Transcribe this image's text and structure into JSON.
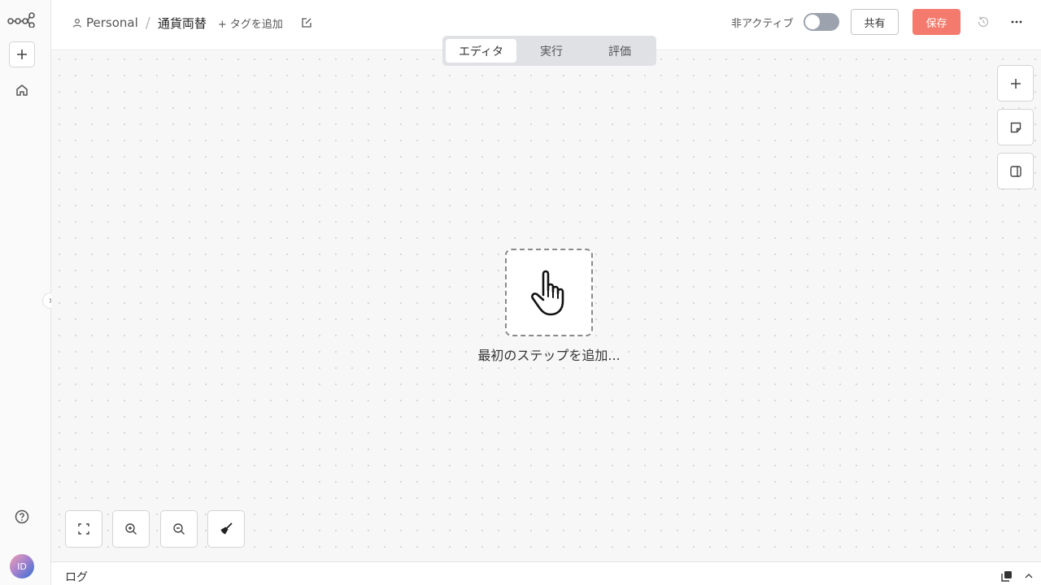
{
  "sidebar": {
    "logo_icon": "workflow-logo-icon",
    "avatar_initials": "ID"
  },
  "header": {
    "project": "Personal",
    "separator": "/",
    "workflow_title": "通貨両替",
    "add_tag": "+ タグを追加",
    "status_label": "非アクティブ",
    "active": false,
    "share_label": "共有",
    "save_label": "保存",
    "save_color": "#f37a6c"
  },
  "tabs": [
    {
      "label": "エディタ",
      "active": true
    },
    {
      "label": "実行",
      "active": false
    },
    {
      "label": "評価",
      "active": false
    }
  ],
  "canvas": {
    "add_first_step": "最初のステップを追加..."
  },
  "log": {
    "label": "ログ"
  }
}
